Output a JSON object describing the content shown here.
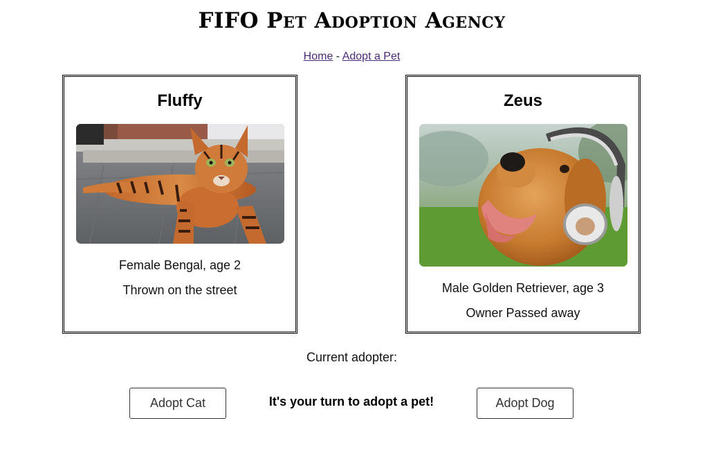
{
  "page": {
    "title": "FIFO Pet Adoption Agency"
  },
  "breadcrumb": {
    "home_label": "Home",
    "separator": " - ",
    "adopt_label": "Adopt a Pet"
  },
  "cat": {
    "name": "Fluffy",
    "description": "Female Bengal, age 2",
    "story": "Thrown on the street"
  },
  "dog": {
    "name": "Zeus",
    "description": "Male Golden Retriever, age 3",
    "story": "Owner Passed away"
  },
  "adopter": {
    "label": "Current adopter:",
    "value": ""
  },
  "actions": {
    "adopt_cat_label": "Adopt Cat",
    "adopt_dog_label": "Adopt Dog",
    "turn_message": "It's your turn to adopt a pet!"
  },
  "colors": {
    "link": "#4b2a7a",
    "border": "#000000"
  }
}
